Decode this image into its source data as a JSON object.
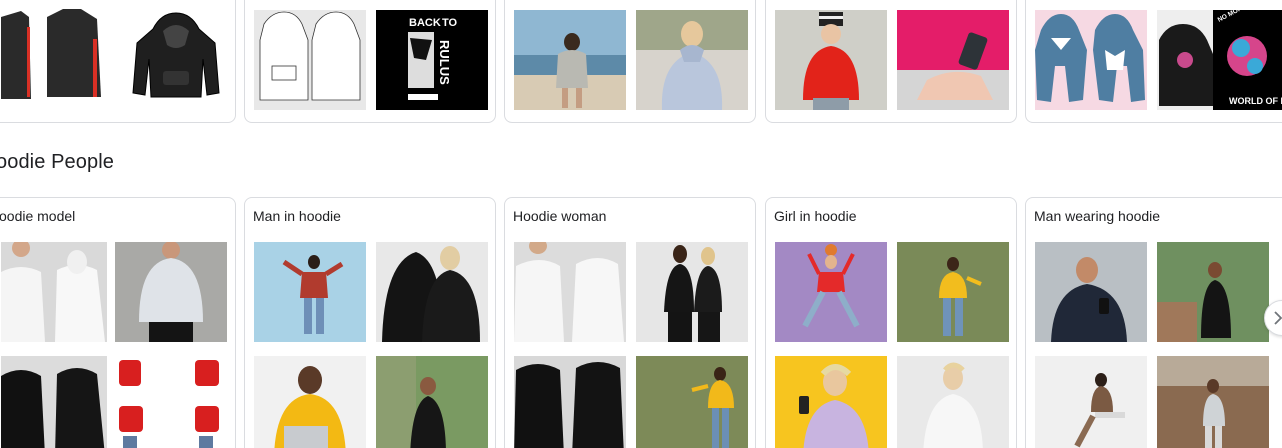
{
  "top_cards": [
    {
      "thumbs": [
        "black jacket with red stripe flat drawing",
        "black hoodie outline drawing"
      ]
    },
    {
      "thumbs": [
        "white hoodie technical sketch",
        "black poster graphic"
      ]
    },
    {
      "thumbs": [
        "woman in grey hoodie at beach",
        "woman in light blue hoodie"
      ]
    },
    {
      "thumbs": [
        "child in red hoodie",
        "person in pink hoodie with phone"
      ]
    },
    {
      "thumbs": [
        "blue hoodie template on pink",
        "black hoodie with rose print"
      ]
    }
  ],
  "top_partial_text": {
    "poster_line1": "BACK",
    "poster_line1_cut": "TO",
    "poster_vertical": "RULUS",
    "print_arc": "NO MORE PAIN EVERYTHING THAT",
    "print_footer": "WORLD OF R"
  },
  "section": {
    "title": "oodie People"
  },
  "people_cards": [
    {
      "title": "oodie model"
    },
    {
      "title": "Man in hoodie"
    },
    {
      "title": "Hoodie woman"
    },
    {
      "title": "Girl in hoodie"
    },
    {
      "title": "Man wearing hoodie"
    }
  ],
  "icons": {
    "next_arrow": "chevron-right-icon"
  },
  "colors": {
    "border": "#dadce0",
    "text": "#202124"
  }
}
